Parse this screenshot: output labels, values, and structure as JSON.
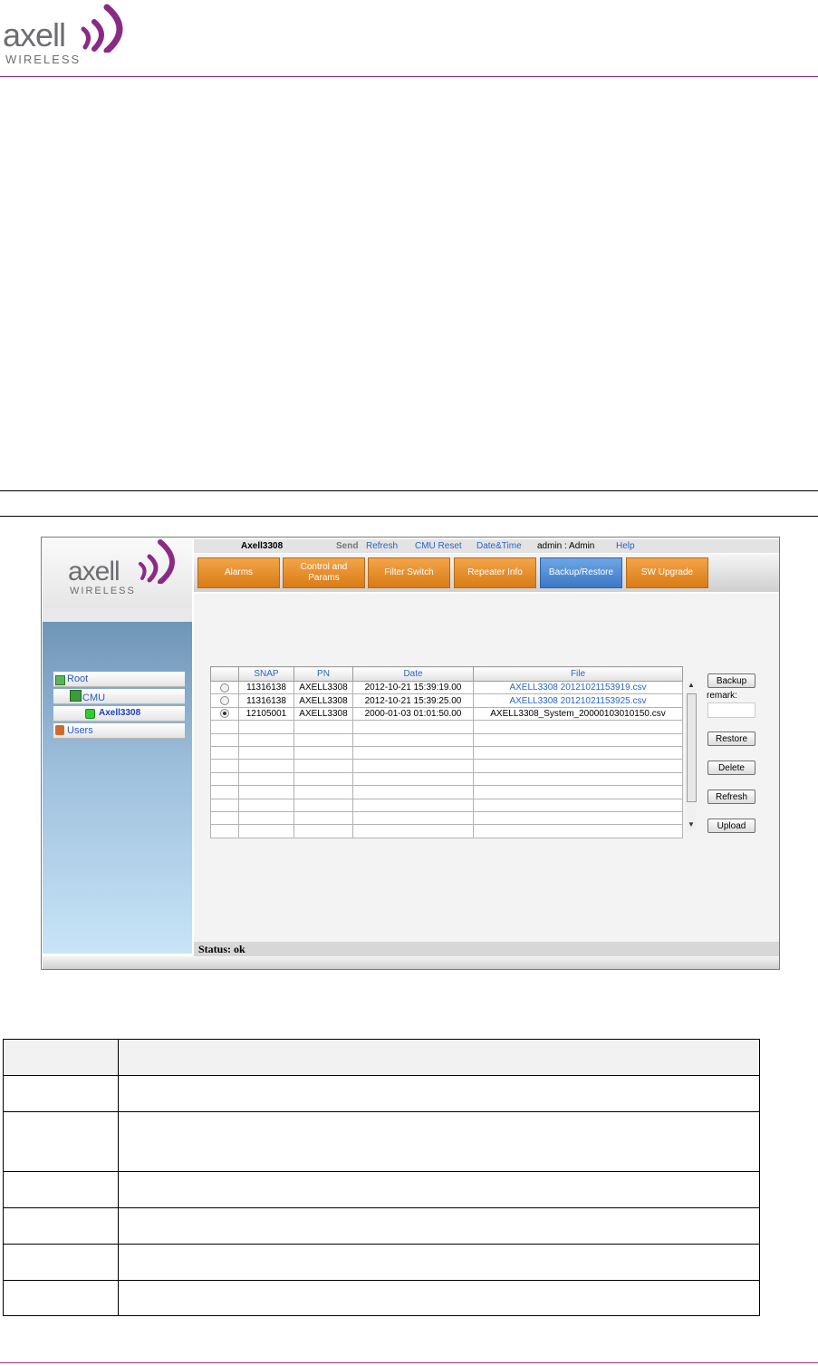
{
  "page": {
    "logo": {
      "word": "axell",
      "sub": "WIRELESS"
    },
    "colors": {
      "accent_purple": "#8a2a84",
      "logo_gray": "#6d6e71",
      "orange_tab": "#e28a23",
      "blue_tab": "#4a88d3",
      "link_blue": "#2a66c4"
    }
  },
  "app": {
    "logo": {
      "word": "axell",
      "sub": "WIRELESS"
    },
    "topbar": {
      "device": "Axell3308",
      "send": "Send",
      "refresh": "Refresh",
      "cmu_reset": "CMU Reset",
      "datetime": "Date&Time",
      "user": "admin : Admin",
      "help": "Help"
    },
    "tabs": [
      {
        "label": "Alarms"
      },
      {
        "label": "Control and Params"
      },
      {
        "label": "Filter Switch"
      },
      {
        "label": "Repeater Info"
      },
      {
        "label": "Backup/Restore",
        "active": true
      },
      {
        "label": "SW Upgrade"
      }
    ],
    "tree": {
      "root": "Root",
      "cmu": "CMU",
      "device": "Axell3308",
      "users": "Users"
    },
    "grid": {
      "headers": [
        "",
        "SNAP",
        "PN",
        "Date",
        "File"
      ],
      "rows": [
        {
          "selected": false,
          "snap": "11316138",
          "pn": "AXELL3308",
          "date": "2012-10-21 15:39:19.00",
          "file": "AXELL3308 20121021153919.csv",
          "file_link": true
        },
        {
          "selected": false,
          "snap": "11316138",
          "pn": "AXELL3308",
          "date": "2012-10-21 15:39:25.00",
          "file": "AXELL3308 20121021153925.csv",
          "file_link": true
        },
        {
          "selected": true,
          "snap": "12105001",
          "pn": "AXELL3308",
          "date": "2000-01-03 01:01:50.00",
          "file": "AXELL3308_System_20000103010150.csv",
          "file_link": false
        }
      ],
      "empty_rows": 9
    },
    "buttons": {
      "backup": "Backup",
      "remark_label": "remark:",
      "restore": "Restore",
      "delete": "Delete",
      "refresh": "Refresh",
      "upload": "Upload"
    },
    "status": "Status: ok"
  }
}
